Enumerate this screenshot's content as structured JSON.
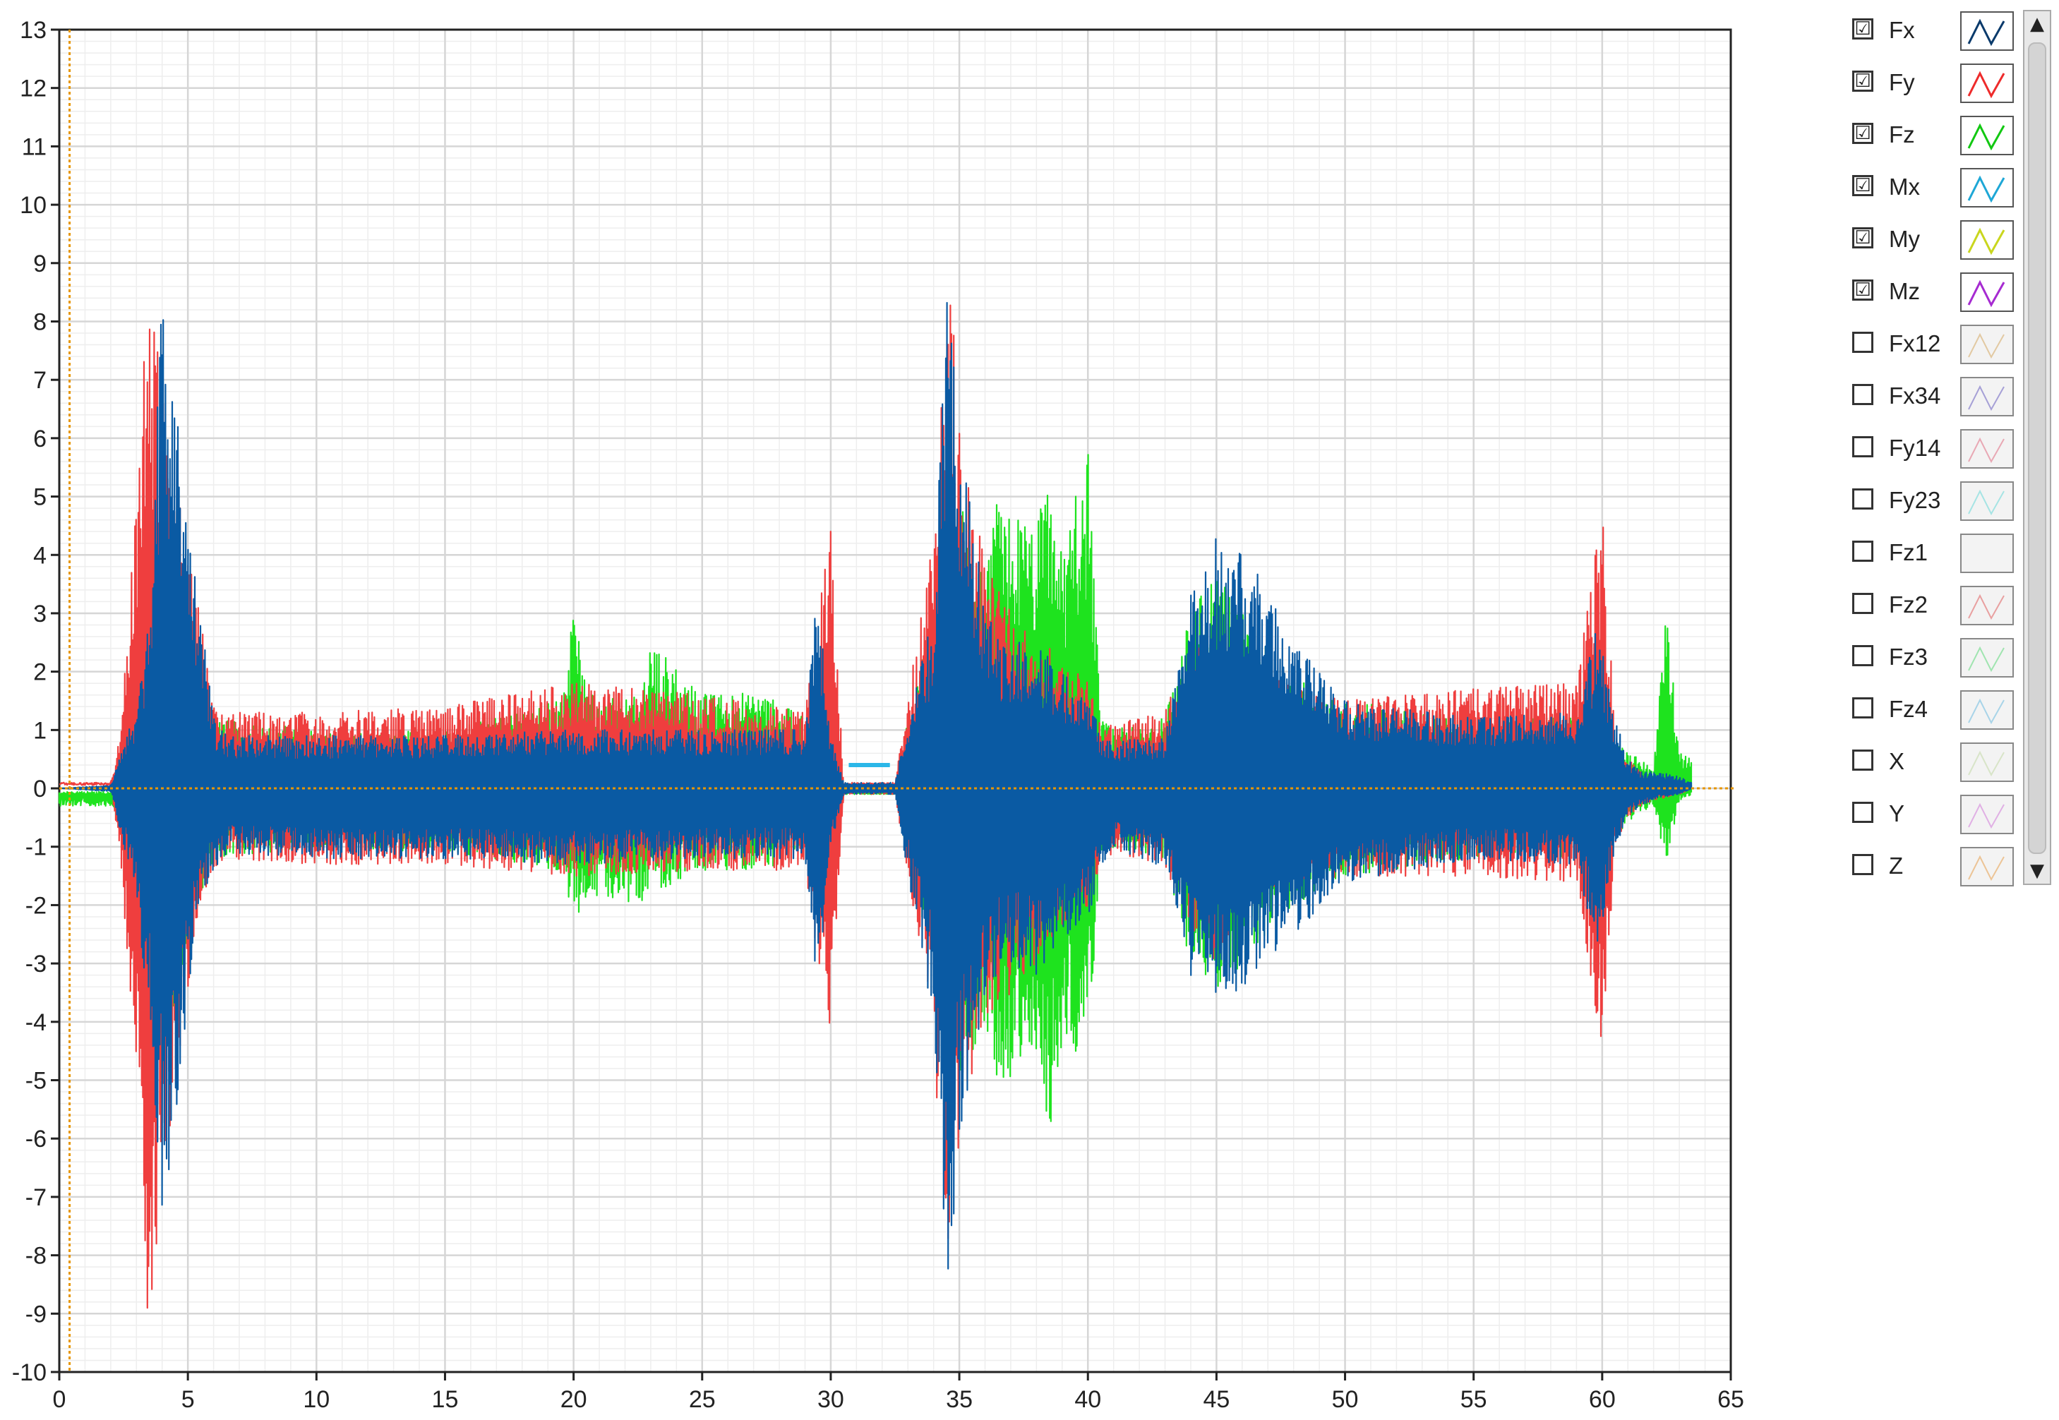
{
  "chart_data": {
    "type": "line",
    "title": "",
    "xlabel": "",
    "ylabel": "",
    "xlim": [
      0,
      65
    ],
    "ylim": [
      -10,
      13
    ],
    "x_ticks": [
      "0",
      "5",
      "10",
      "15",
      "20",
      "25",
      "30",
      "35",
      "40",
      "45",
      "50",
      "55",
      "60",
      "65"
    ],
    "y_ticks": [
      "13",
      "12",
      "11",
      "10",
      "9",
      "8",
      "7",
      "6",
      "5",
      "4",
      "3",
      "2",
      "1",
      "0",
      "-1",
      "-2",
      "-3",
      "-4",
      "-5",
      "-6",
      "-7",
      "-8",
      "-9",
      "-10"
    ],
    "grid": true,
    "legend_placement": "right",
    "cursor_lines": {
      "x": 0.4,
      "y": 0,
      "color": "#e69500"
    },
    "draw_order": [
      "Fz",
      "Fy",
      "Fx"
    ],
    "series": [
      {
        "name": "Fx",
        "color": "#0a5aa3",
        "envelope": {
          "x": [
            0,
            2.0,
            2.4,
            3.0,
            3.5,
            4.0,
            4.5,
            5.0,
            5.5,
            6.0,
            6.5,
            10,
            15,
            20,
            25,
            29,
            29.5,
            30.0,
            30.5,
            31.0,
            32.5,
            33.0,
            34.0,
            34.5,
            35.0,
            36,
            37,
            38,
            39,
            40,
            40.5,
            41,
            43,
            44,
            45,
            46,
            47,
            48,
            50,
            55,
            59,
            59.8,
            60.5,
            61.0,
            61.5,
            62,
            63,
            63.5
          ],
          "upper": [
            0,
            0.05,
            0.6,
            1.5,
            3.0,
            8.5,
            7.0,
            4.5,
            3.0,
            1.2,
            0.9,
            0.9,
            0.9,
            1.0,
            1.0,
            1.0,
            3.5,
            0.9,
            0.1,
            0.1,
            0.1,
            1.2,
            3.0,
            8.5,
            6.5,
            3.0,
            2.5,
            2.5,
            2.0,
            1.8,
            1.0,
            0.8,
            0.9,
            3.3,
            4.3,
            4.0,
            3.5,
            2.5,
            1.5,
            1.2,
            1.3,
            2.8,
            1.2,
            0.5,
            0.3,
            0.3,
            0.2,
            0.1
          ],
          "lower": [
            0,
            -0.05,
            -0.8,
            -2.0,
            -4.0,
            -7.2,
            -6.0,
            -3.5,
            -2.0,
            -1.5,
            -1.1,
            -1.2,
            -1.2,
            -1.3,
            -1.2,
            -1.2,
            -3.5,
            -1.0,
            -0.1,
            -0.1,
            -0.1,
            -1.5,
            -4.0,
            -9.3,
            -6.0,
            -3.5,
            -3.0,
            -3.2,
            -2.7,
            -2.3,
            -1.4,
            -1.0,
            -1.4,
            -3.2,
            -3.5,
            -3.5,
            -3.0,
            -2.5,
            -1.6,
            -1.2,
            -1.3,
            -2.8,
            -1.0,
            -0.5,
            -0.3,
            -0.2,
            -0.1,
            0
          ]
        }
      },
      {
        "name": "Fy",
        "color": "#ef3e3e",
        "envelope": {
          "x": [
            0,
            2.0,
            2.4,
            3.0,
            3.4,
            4.0,
            4.5,
            5.0,
            5.5,
            6.0,
            6.5,
            10,
            15,
            20,
            25,
            29,
            30.0,
            30.5,
            31.0,
            32.5,
            33.0,
            34.0,
            34.5,
            35.0,
            36,
            37,
            38,
            39,
            40,
            40.5,
            41,
            43,
            44,
            45,
            46,
            47,
            48,
            50,
            55,
            59,
            60.0,
            60.5,
            61.0,
            61.5,
            62,
            63,
            63.5
          ],
          "upper": [
            0.1,
            0.1,
            1.0,
            5.0,
            8.8,
            7.5,
            5.0,
            4.5,
            3.0,
            1.4,
            1.3,
            1.3,
            1.4,
            1.8,
            1.6,
            1.3,
            4.5,
            0.1,
            0.1,
            0.1,
            1.5,
            4.5,
            9.5,
            6.5,
            4.0,
            3.0,
            2.5,
            2.3,
            1.8,
            1.2,
            1.1,
            1.3,
            2.5,
            3.0,
            2.5,
            2.0,
            1.7,
            1.5,
            1.7,
            1.8,
            4.8,
            1.0,
            0.5,
            0.3,
            0.2,
            0.1,
            0.1
          ],
          "lower": [
            0.1,
            0.1,
            -1.5,
            -5.0,
            -9.5,
            -7.0,
            -5.0,
            -3.5,
            -2.0,
            -1.4,
            -1.2,
            -1.3,
            -1.3,
            -1.5,
            -1.4,
            -1.4,
            -4.5,
            -0.1,
            -0.1,
            -0.1,
            -1.5,
            -4.0,
            -9.8,
            -6.0,
            -4.0,
            -3.5,
            -3.0,
            -2.5,
            -2.0,
            -1.3,
            -1.1,
            -1.3,
            -2.5,
            -3.0,
            -2.5,
            -2.0,
            -1.6,
            -1.5,
            -1.5,
            -1.6,
            -4.5,
            -1.0,
            -0.5,
            -0.3,
            -0.2,
            -0.1,
            0
          ]
        }
      },
      {
        "name": "Fz",
        "color": "#1ee31e",
        "envelope": {
          "x": [
            0,
            2.0,
            2.4,
            3.0,
            4.0,
            5.0,
            6.0,
            10,
            15,
            19.5,
            20.0,
            20.5,
            21,
            22.5,
            23,
            25,
            27,
            29,
            30.0,
            30.5,
            31.0,
            32.5,
            33.0,
            34.0,
            35.0,
            36.0,
            36.5,
            37.0,
            38.0,
            38.5,
            39.0,
            40.0,
            40.5,
            41,
            43,
            44,
            45,
            46,
            47,
            48,
            50,
            55,
            59,
            60.0,
            61.0,
            61.5,
            62.0,
            62.5,
            63.0,
            63.5
          ],
          "upper": [
            -0.1,
            -0.1,
            0.8,
            2.0,
            4.5,
            3.5,
            1.2,
            1.0,
            1.0,
            1.5,
            3.0,
            1.8,
            1.5,
            1.6,
            2.5,
            1.6,
            1.7,
            1.2,
            1.0,
            -0.1,
            -0.1,
            -0.1,
            1.2,
            3.0,
            5.0,
            3.5,
            5.0,
            4.8,
            4.5,
            5.5,
            4.0,
            5.9,
            1.2,
            1.0,
            1.2,
            3.0,
            3.8,
            3.0,
            2.5,
            2.0,
            1.5,
            1.2,
            1.2,
            1.0,
            0.6,
            0.5,
            0.3,
            3.2,
            0.6,
            0.5
          ],
          "lower": [
            -0.3,
            -0.3,
            -0.8,
            -2.0,
            -4.5,
            -3.0,
            -1.2,
            -1.0,
            -1.1,
            -1.4,
            -2.2,
            -2.0,
            -1.8,
            -2.0,
            -1.8,
            -1.4,
            -1.4,
            -1.2,
            -1.0,
            -0.1,
            -0.1,
            -0.1,
            -1.2,
            -3.0,
            -5.0,
            -4.0,
            -5.0,
            -5.0,
            -4.5,
            -6.0,
            -4.5,
            -4.5,
            -1.2,
            -1.0,
            -1.2,
            -3.0,
            -3.5,
            -3.0,
            -2.5,
            -2.0,
            -1.5,
            -1.2,
            -1.2,
            -1.0,
            -0.6,
            -0.4,
            -0.3,
            -1.3,
            -0.2,
            -0.1
          ]
        }
      },
      {
        "name": "Mx",
        "color": "#2bb7e8",
        "segments": [
          [
            30.7,
            32.3,
            0.4
          ]
        ]
      }
    ]
  },
  "legend": {
    "items": [
      {
        "label": "Fx",
        "checked": true,
        "mark": "☑",
        "color": "#0a3a6b"
      },
      {
        "label": "Fy",
        "checked": true,
        "mark": "☑",
        "color": "#ee2b2b"
      },
      {
        "label": "Fz",
        "checked": true,
        "mark": "☑",
        "color": "#12c812"
      },
      {
        "label": "Mx",
        "checked": true,
        "mark": "☑",
        "color": "#1ea7d6"
      },
      {
        "label": "My",
        "checked": true,
        "mark": "☑",
        "color": "#c9d61e"
      },
      {
        "label": "Mz",
        "checked": true,
        "mark": "☑",
        "color": "#a62bd1"
      },
      {
        "label": "Fx12",
        "checked": false,
        "mark": "",
        "color": "#e2c9a2"
      },
      {
        "label": "Fx34",
        "checked": false,
        "mark": "",
        "color": "#a6a0d6"
      },
      {
        "label": "Fy14",
        "checked": false,
        "mark": "",
        "color": "#e8a8b4"
      },
      {
        "label": "Fy23",
        "checked": false,
        "mark": "",
        "color": "#a6e4e4"
      },
      {
        "label": "Fz1",
        "checked": false,
        "mark": "",
        "color": ""
      },
      {
        "label": "Fz2",
        "checked": false,
        "mark": "",
        "color": "#e8a0a0"
      },
      {
        "label": "Fz3",
        "checked": false,
        "mark": "",
        "color": "#a0e4b0"
      },
      {
        "label": "Fz4",
        "checked": false,
        "mark": "",
        "color": "#a8d4e8"
      },
      {
        "label": "X",
        "checked": false,
        "mark": "",
        "color": "#d8e4c8"
      },
      {
        "label": "Y",
        "checked": false,
        "mark": "",
        "color": "#e0b0e4"
      },
      {
        "label": "Z",
        "checked": false,
        "mark": "",
        "color": "#ecc496"
      }
    ]
  },
  "scrollbar": {
    "up_icon": "▲",
    "down_icon": "▼"
  }
}
